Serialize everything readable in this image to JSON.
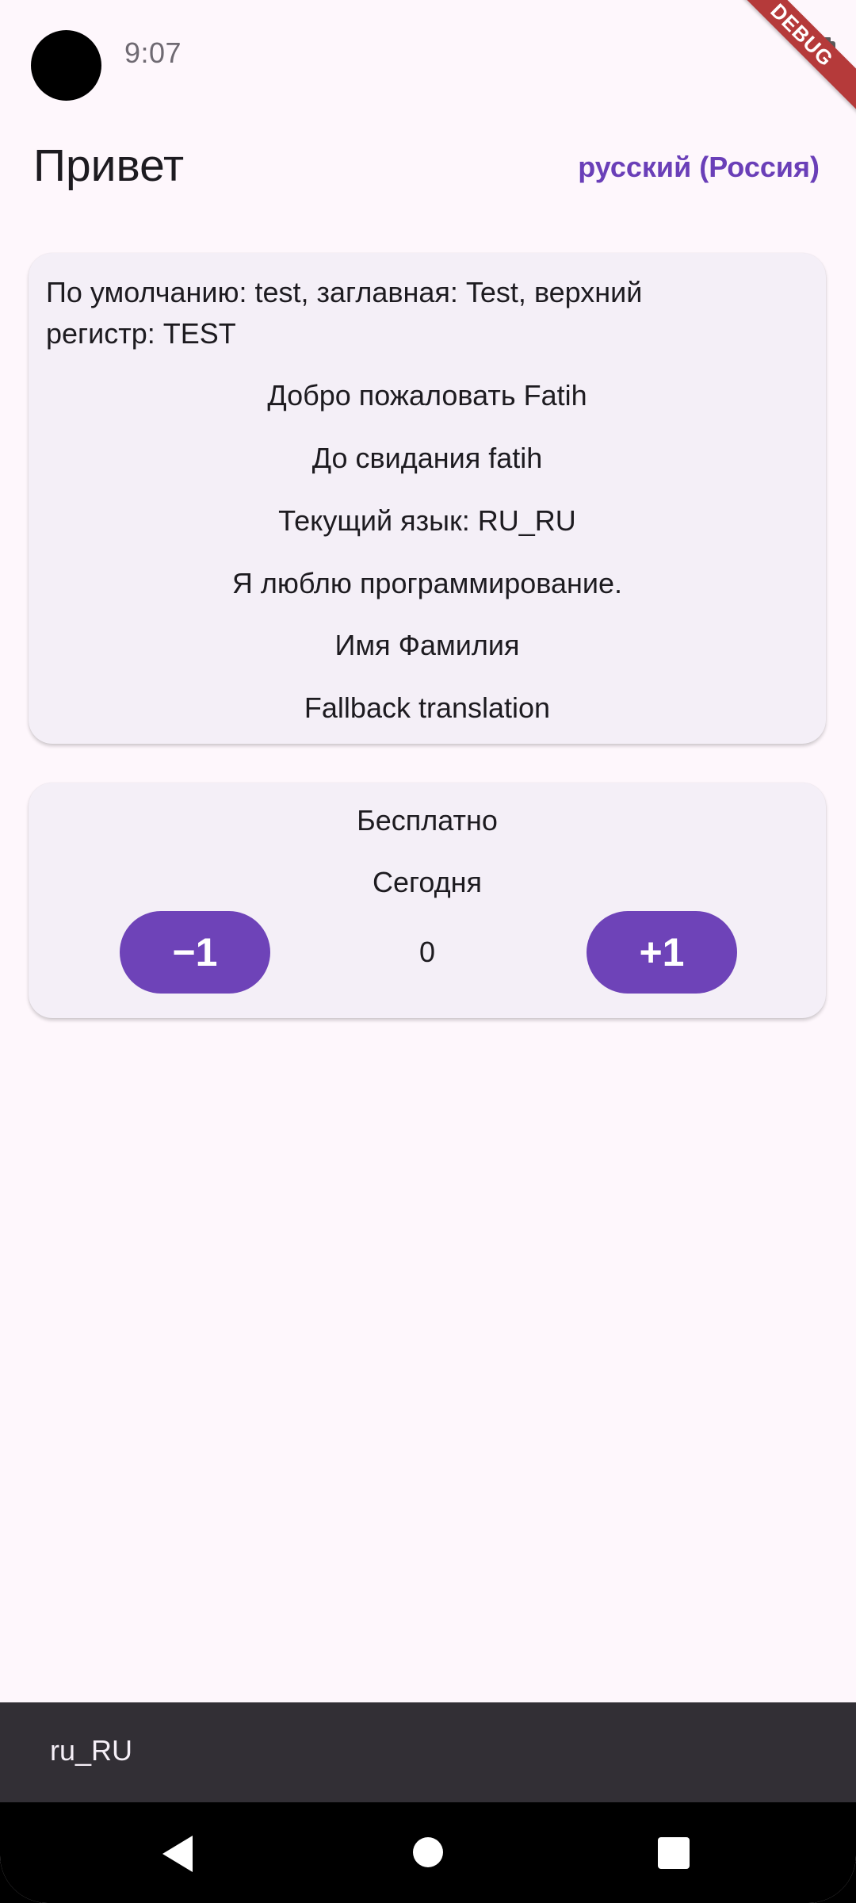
{
  "status_bar": {
    "time": "9:07",
    "debug_label": "DEBUG"
  },
  "app_bar": {
    "title": "Привет",
    "locale_button": "русский (Россия)"
  },
  "translations_card": {
    "lines": [
      "По умолчанию: test, заглавная: Test, верхний регистр: TEST",
      "Добро пожаловать Fatih",
      "До свидания fatih",
      "Текущий язык: RU_RU",
      "Я люблю программирование.",
      "Имя Фамилия",
      "Fallback translation"
    ]
  },
  "counter_card": {
    "price_label": "Бесплатно",
    "date_label": "Сегодня",
    "decrement_label": "−1",
    "increment_label": "+1",
    "count": "0"
  },
  "snackbar": {
    "text": "ru_RU"
  },
  "colors": {
    "background": "#fef7fc",
    "card": "#f4eff7",
    "accent": "#6e43b8",
    "snackbar": "#322f35"
  }
}
